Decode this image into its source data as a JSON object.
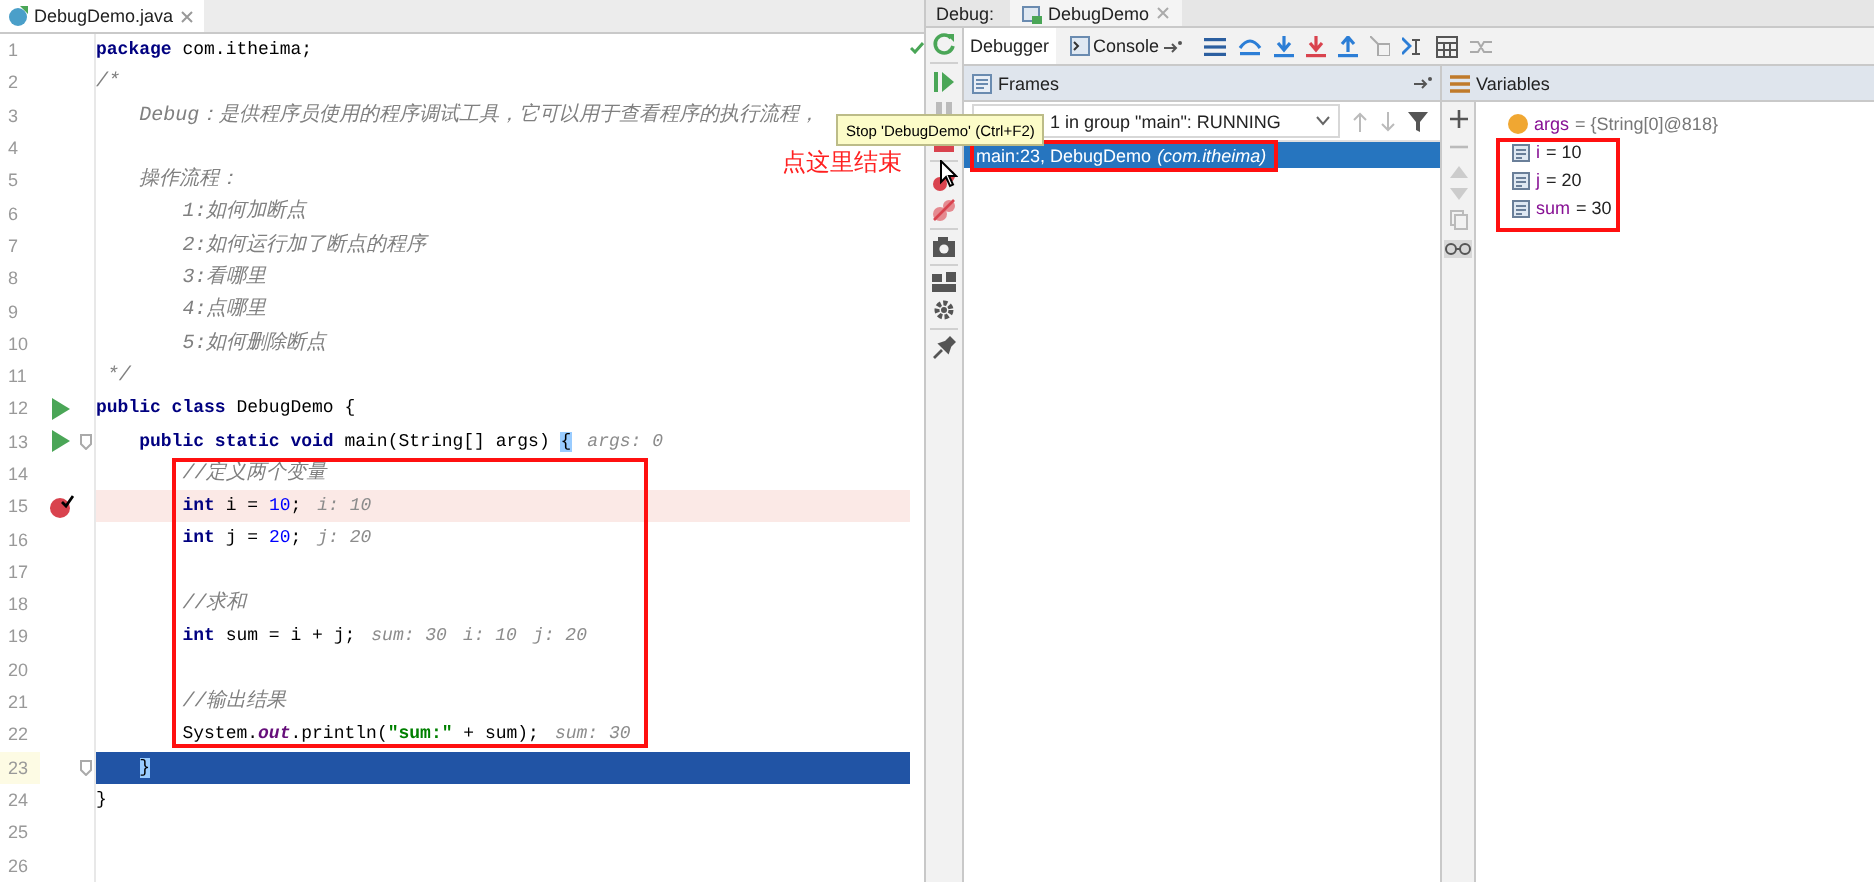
{
  "editor": {
    "tab": {
      "title": "DebugDemo.java",
      "selected": true
    },
    "lines": [
      {
        "num": "1",
        "run": false,
        "breakpoint": false,
        "current": false,
        "fold": false,
        "tokens": [
          {
            "kind": "kw",
            "text": "package"
          },
          {
            "kind": "plain",
            "text": " com.itheima;"
          }
        ]
      },
      {
        "num": "2",
        "run": false,
        "breakpoint": false,
        "current": false,
        "fold": false,
        "tokens": [
          {
            "kind": "comment",
            "text": "/*"
          }
        ]
      },
      {
        "num": "3",
        "run": false,
        "breakpoint": false,
        "current": false,
        "fold": false,
        "tokens": [
          {
            "kind": "comment",
            "text": "    Debug：是供程序员使用的程序调试工具，它可以用于查看程序的执行流程，"
          }
        ]
      },
      {
        "num": "4",
        "run": false,
        "breakpoint": false,
        "current": false,
        "fold": false
      },
      {
        "num": "5",
        "run": false,
        "breakpoint": false,
        "current": false,
        "fold": false,
        "tokens": [
          {
            "kind": "comment",
            "text": "    操作流程："
          }
        ]
      },
      {
        "num": "6",
        "run": false,
        "breakpoint": false,
        "current": false,
        "fold": false,
        "tokens": [
          {
            "kind": "comment",
            "text": "        1:如何加断点"
          }
        ]
      },
      {
        "num": "7",
        "run": false,
        "breakpoint": false,
        "current": false,
        "fold": false,
        "tokens": [
          {
            "kind": "comment",
            "text": "        2:如何运行加了断点的程序"
          }
        ]
      },
      {
        "num": "8",
        "run": false,
        "breakpoint": false,
        "current": false,
        "fold": false,
        "tokens": [
          {
            "kind": "comment",
            "text": "        3:看哪里"
          }
        ]
      },
      {
        "num": "9",
        "run": false,
        "breakpoint": false,
        "current": false,
        "fold": false,
        "tokens": [
          {
            "kind": "comment",
            "text": "        4:点哪里"
          }
        ]
      },
      {
        "num": "10",
        "run": false,
        "breakpoint": false,
        "current": false,
        "fold": false,
        "tokens": [
          {
            "kind": "comment",
            "text": "        5:如何删除断点"
          }
        ]
      },
      {
        "num": "11",
        "run": false,
        "breakpoint": false,
        "current": false,
        "fold": false,
        "tokens": [
          {
            "kind": "comment",
            "text": " */"
          }
        ]
      },
      {
        "num": "12",
        "run": true,
        "breakpoint": false,
        "current": false,
        "fold": false,
        "tokens": [
          {
            "kind": "kw",
            "text": "public class"
          },
          {
            "kind": "plain",
            "text": " DebugDemo {"
          }
        ]
      },
      {
        "num": "13",
        "run": true,
        "breakpoint": false,
        "current": false,
        "fold": true,
        "tokens": [
          {
            "kind": "kw",
            "text": "    public static void"
          },
          {
            "kind": "plain",
            "text": " main(String[] args) "
          },
          {
            "kind": "brace",
            "text": "{"
          },
          {
            "kind": "hint",
            "text": "args: 0"
          }
        ]
      },
      {
        "num": "14",
        "run": false,
        "breakpoint": false,
        "current": false,
        "fold": false,
        "tokens": [
          {
            "kind": "comment",
            "text": "        //定义两个变量"
          }
        ]
      },
      {
        "num": "15",
        "run": false,
        "breakpoint": true,
        "current": false,
        "fold": false,
        "tokens": [
          {
            "kind": "kw",
            "text": "        int"
          },
          {
            "kind": "plain",
            "text": " i = "
          },
          {
            "kind": "num",
            "text": "10"
          },
          {
            "kind": "plain",
            "text": ";"
          },
          {
            "kind": "hint",
            "text": "i: 10"
          }
        ]
      },
      {
        "num": "16",
        "run": false,
        "breakpoint": false,
        "current": false,
        "fold": false,
        "tokens": [
          {
            "kind": "kw",
            "text": "        int"
          },
          {
            "kind": "plain",
            "text": " j = "
          },
          {
            "kind": "num",
            "text": "20"
          },
          {
            "kind": "plain",
            "text": ";"
          },
          {
            "kind": "hint",
            "text": "j: 20"
          }
        ]
      },
      {
        "num": "17",
        "run": false,
        "breakpoint": false,
        "current": false,
        "fold": false
      },
      {
        "num": "18",
        "run": false,
        "breakpoint": false,
        "current": false,
        "fold": false,
        "tokens": [
          {
            "kind": "comment",
            "text": "        //求和"
          }
        ]
      },
      {
        "num": "19",
        "run": false,
        "breakpoint": false,
        "current": false,
        "fold": false,
        "tokens": [
          {
            "kind": "kw",
            "text": "        int"
          },
          {
            "kind": "plain",
            "text": " sum = i + j;"
          },
          {
            "kind": "hint",
            "text": "sum: 30"
          },
          {
            "kind": "hint",
            "text": "i: 10"
          },
          {
            "kind": "hint",
            "text": "j: 20"
          }
        ]
      },
      {
        "num": "20",
        "run": false,
        "breakpoint": false,
        "current": false,
        "fold": false
      },
      {
        "num": "21",
        "run": false,
        "breakpoint": false,
        "current": false,
        "fold": false,
        "tokens": [
          {
            "kind": "comment",
            "text": "        //输出结果"
          }
        ]
      },
      {
        "num": "22",
        "run": false,
        "breakpoint": false,
        "current": false,
        "fold": false,
        "tokens": [
          {
            "kind": "plain",
            "text": "        System."
          },
          {
            "kind": "field",
            "text": "out"
          },
          {
            "kind": "plain",
            "text": ".println("
          },
          {
            "kind": "str",
            "text": "\"sum:\""
          },
          {
            "kind": "plain",
            "text": " + sum);"
          },
          {
            "kind": "hint",
            "text": "sum: 30"
          }
        ]
      },
      {
        "num": "23",
        "run": false,
        "breakpoint": false,
        "current": true,
        "fold": true,
        "tokens": [
          {
            "kind": "brace",
            "text": "    }"
          }
        ]
      },
      {
        "num": "24",
        "run": false,
        "breakpoint": false,
        "current": false,
        "fold": false,
        "tokens": [
          {
            "kind": "plain",
            "text": "}"
          }
        ]
      },
      {
        "num": "25",
        "run": false,
        "breakpoint": false,
        "current": false,
        "fold": false
      },
      {
        "num": "26",
        "run": false,
        "breakpoint": false,
        "current": false,
        "fold": false
      }
    ]
  },
  "tooltip": "Stop 'DebugDemo' (Ctrl+F2)",
  "annotation": "点这里结束",
  "debug": {
    "label": "Debug:",
    "session_tab": "DebugDemo",
    "tabs": [
      {
        "label": "Debugger",
        "selected": true
      },
      {
        "label": "Console",
        "selected": false
      }
    ],
    "frames": {
      "title": "Frames",
      "thread": "1 in group \"main\": RUNNING",
      "items": [
        {
          "text": "main:23, DebugDemo",
          "package": "(com.itheima)",
          "selected": true
        }
      ]
    },
    "variables": {
      "title": "Variables",
      "items": [
        {
          "kind": "param",
          "name": "args",
          "value": "= {String[0]@818}"
        },
        {
          "kind": "local",
          "name": "i",
          "value": "= 10"
        },
        {
          "kind": "local",
          "name": "j",
          "value": "= 20"
        },
        {
          "kind": "local",
          "name": "sum",
          "value": "= 30"
        }
      ]
    }
  }
}
